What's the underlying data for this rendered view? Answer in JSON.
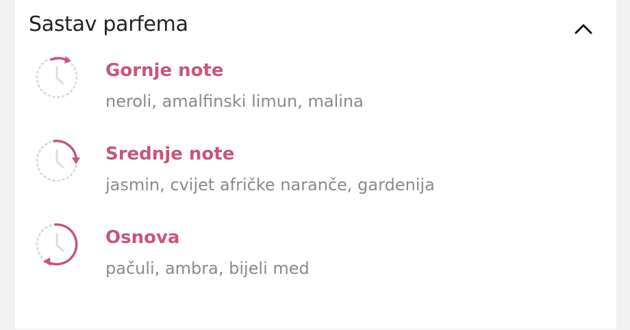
{
  "section": {
    "title": "Sastav parfema",
    "toggle_icon": "chevron-up-icon"
  },
  "notes": [
    {
      "icon": "top-notes-clock-icon",
      "name": "Gornje note",
      "ingredients": "neroli, amalfinski limun, malina"
    },
    {
      "icon": "middle-notes-clock-icon",
      "name": "Srednje note",
      "ingredients": "jasmin, cvijet afričke naranče, gardenija"
    },
    {
      "icon": "base-notes-clock-icon",
      "name": "Osnova",
      "ingredients": "pačuli, ambra, bijeli med"
    }
  ],
  "colors": {
    "accent": "#c8557a",
    "muted_text": "#8a8a8a",
    "title_text": "#222222",
    "dotted_circle": "#dddddd"
  }
}
